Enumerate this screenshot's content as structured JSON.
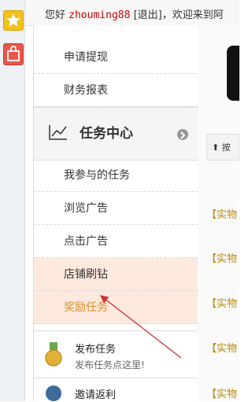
{
  "header": {
    "greeting": "您好",
    "username": "zhouming88",
    "logout": "[退出]，欢迎来到阿"
  },
  "menu": {
    "items_top": [
      "申请提现",
      "财务报表"
    ],
    "section_title": "任务中心",
    "items": [
      "我参与的任务",
      "浏览广告",
      "点击广告",
      "店铺刷钻",
      "奖励任务"
    ]
  },
  "cards": [
    {
      "title": "发布任务",
      "subtitle": "发布任务点这里!"
    },
    {
      "title": "邀请返利"
    }
  ],
  "right_panel": {
    "button_label": "按",
    "tags": [
      "【实物",
      "【实物",
      "【实物",
      "【实物",
      "【实物"
    ]
  },
  "colors": {
    "accent_orange_bg": "#fde9dd",
    "reward_text": "#d98f2a"
  }
}
